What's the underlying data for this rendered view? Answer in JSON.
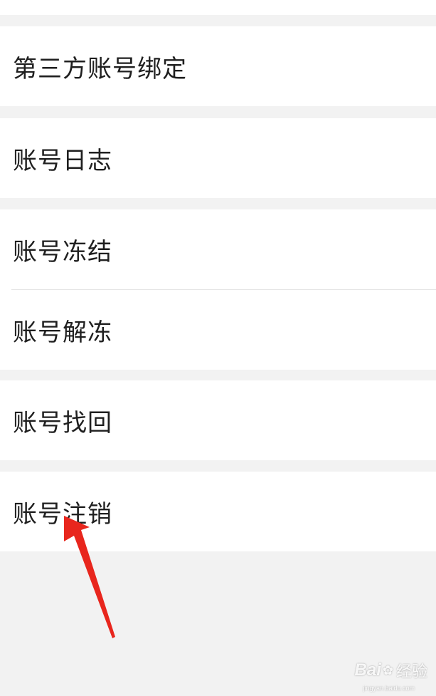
{
  "settings": {
    "items": [
      {
        "label": "第三方账号绑定"
      },
      {
        "label": "账号日志"
      },
      {
        "label": "账号冻结"
      },
      {
        "label": "账号解冻"
      },
      {
        "label": "账号找回"
      },
      {
        "label": "账号注销"
      }
    ]
  },
  "watermark": {
    "brand": "Bai",
    "brand_suffix": "经验",
    "domain": "jingyan.baidu.com"
  },
  "colors": {
    "page_background": "#f2f2f2",
    "row_background": "#ffffff",
    "divider": "#e5e5e5",
    "text": "#1f1f1f",
    "annotation_arrow": "#e8261d"
  }
}
